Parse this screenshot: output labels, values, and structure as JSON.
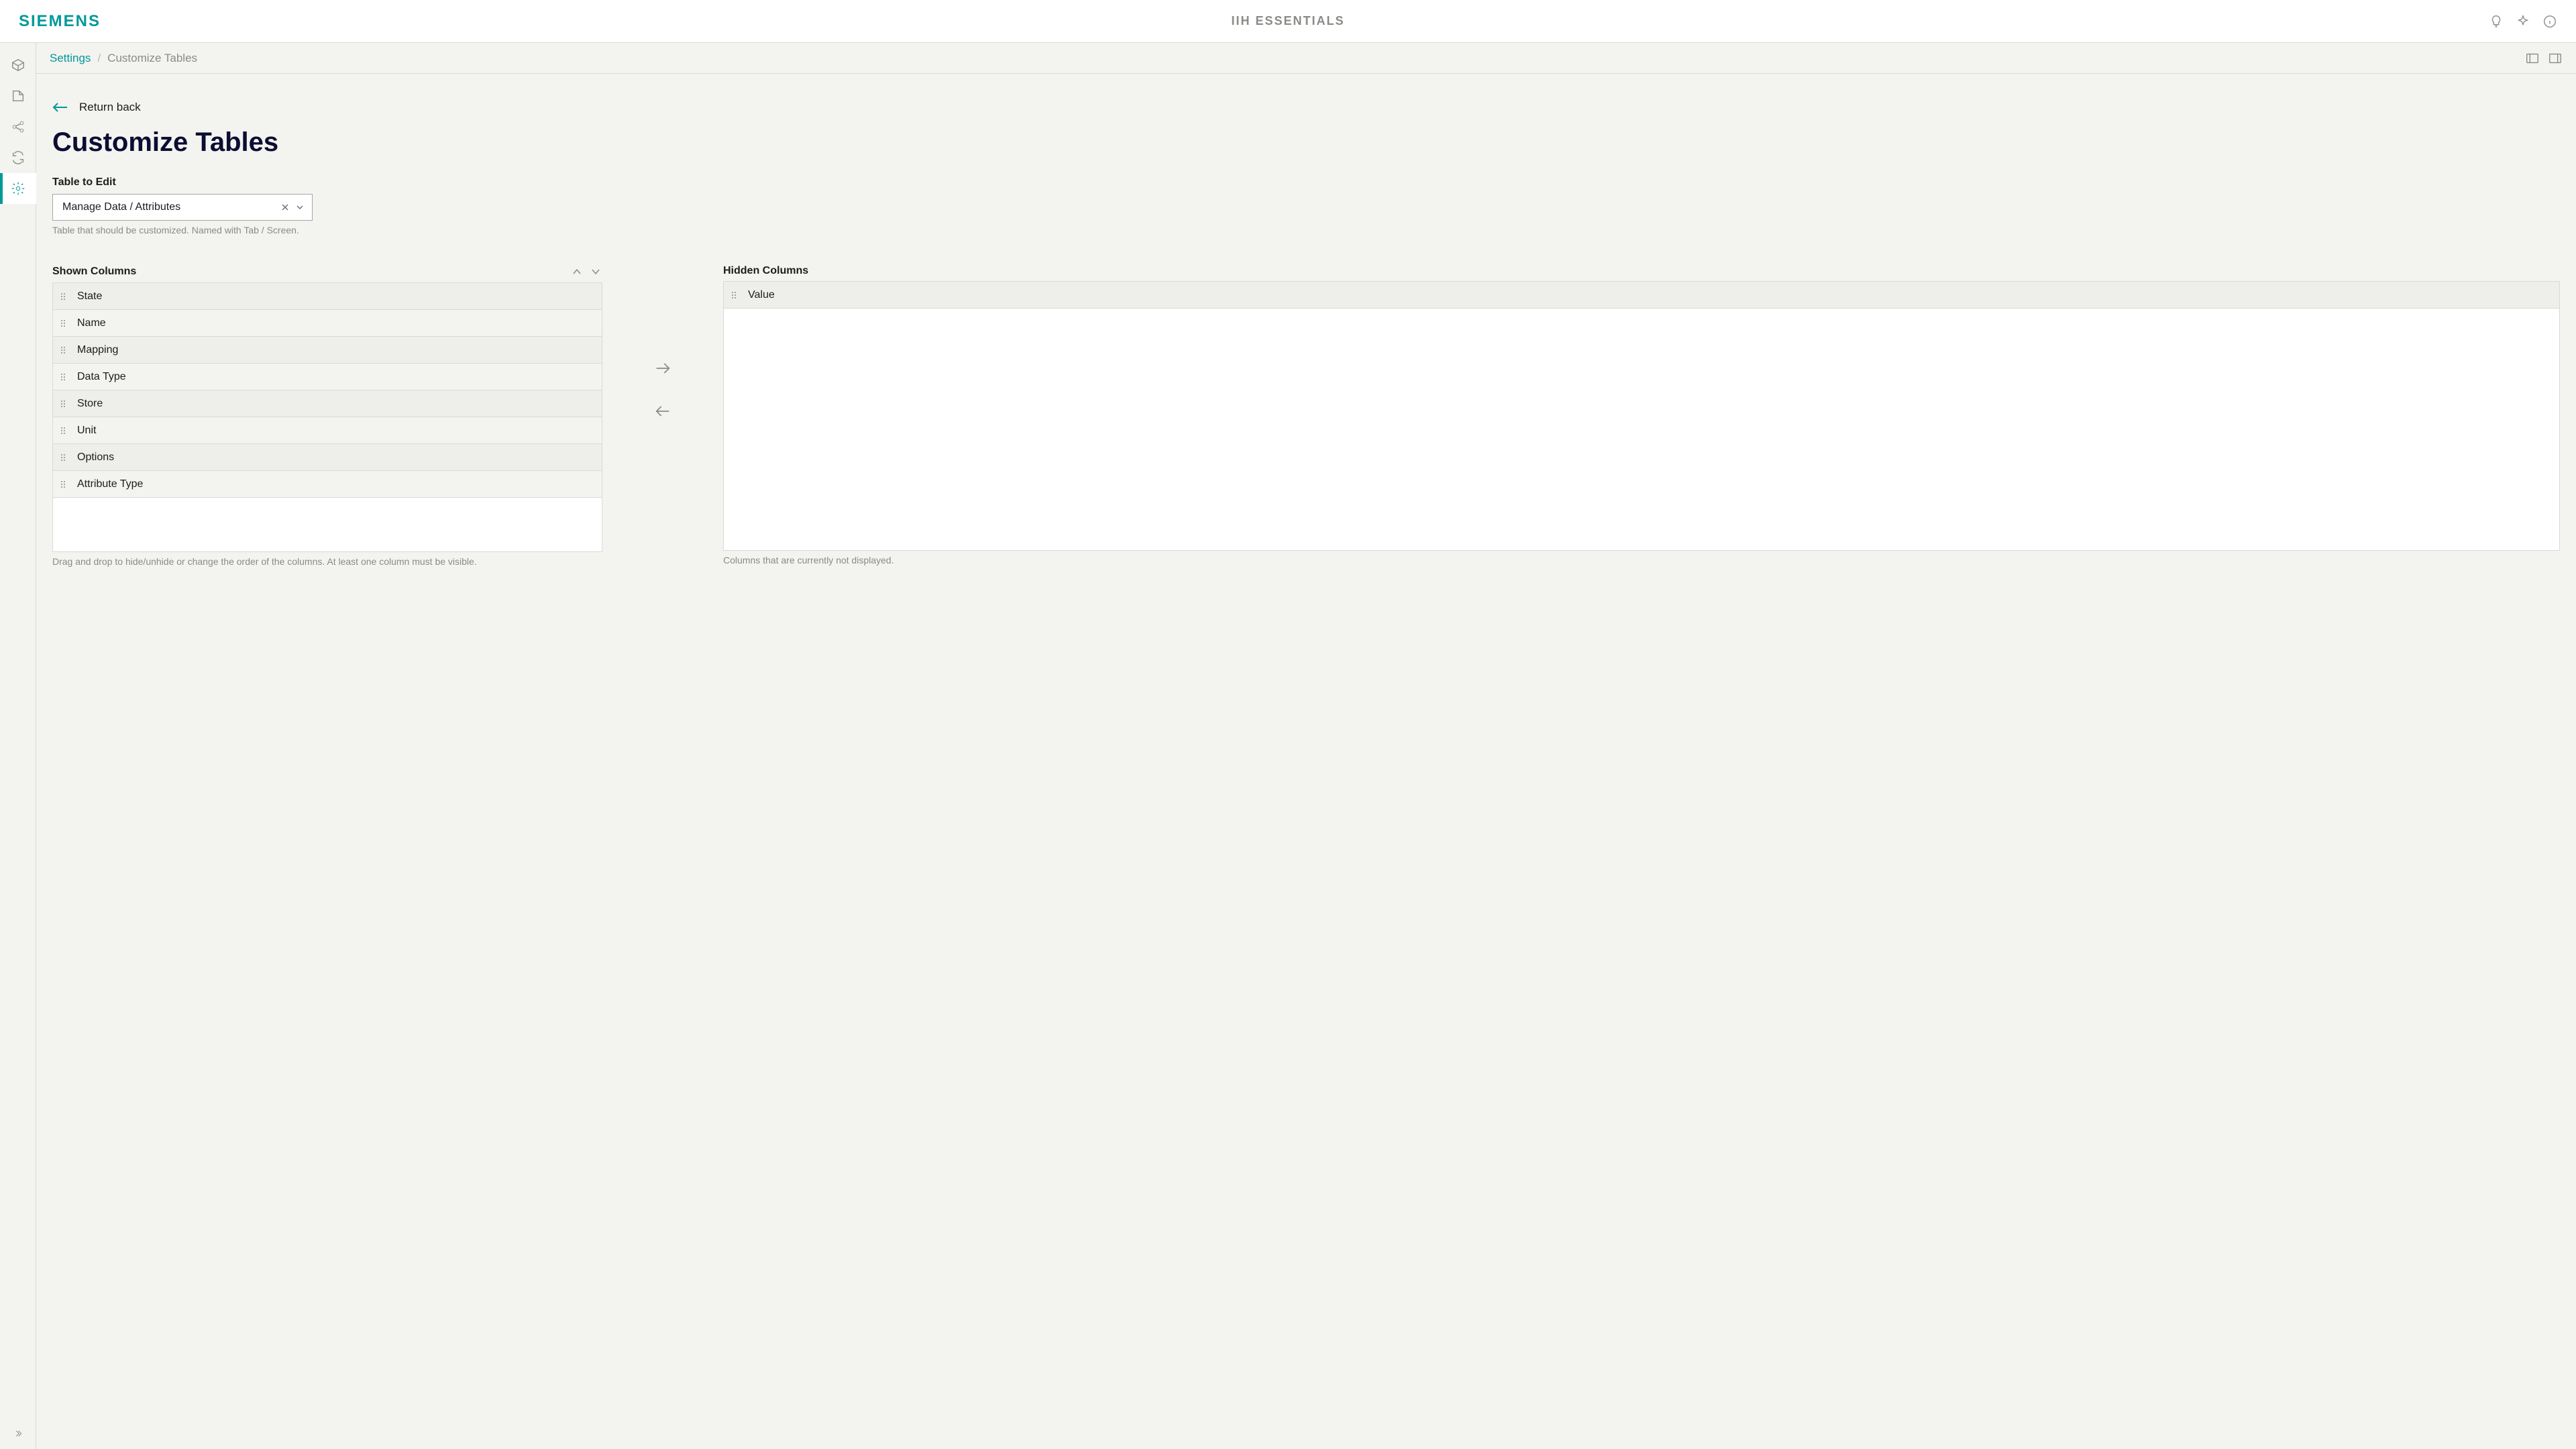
{
  "header": {
    "logo": "SIEMENS",
    "app_title": "IIH ESSENTIALS"
  },
  "breadcrumb": {
    "settings": "Settings",
    "current": "Customize Tables"
  },
  "return_label": "Return back",
  "page_title": "Customize Tables",
  "table_select": {
    "label": "Table to Edit",
    "value": "Manage Data / Attributes",
    "helper": "Table that should be customized. Named with Tab / Screen."
  },
  "shown": {
    "label": "Shown Columns",
    "items": [
      "State",
      "Name",
      "Mapping",
      "Data Type",
      "Store",
      "Unit",
      "Options",
      "Attribute Type"
    ],
    "helper": "Drag and drop to hide/unhide or change the order of the columns. At least one column must be visible."
  },
  "hidden": {
    "label": "Hidden Columns",
    "items": [
      "Value"
    ],
    "helper": "Columns that are currently not displayed."
  }
}
